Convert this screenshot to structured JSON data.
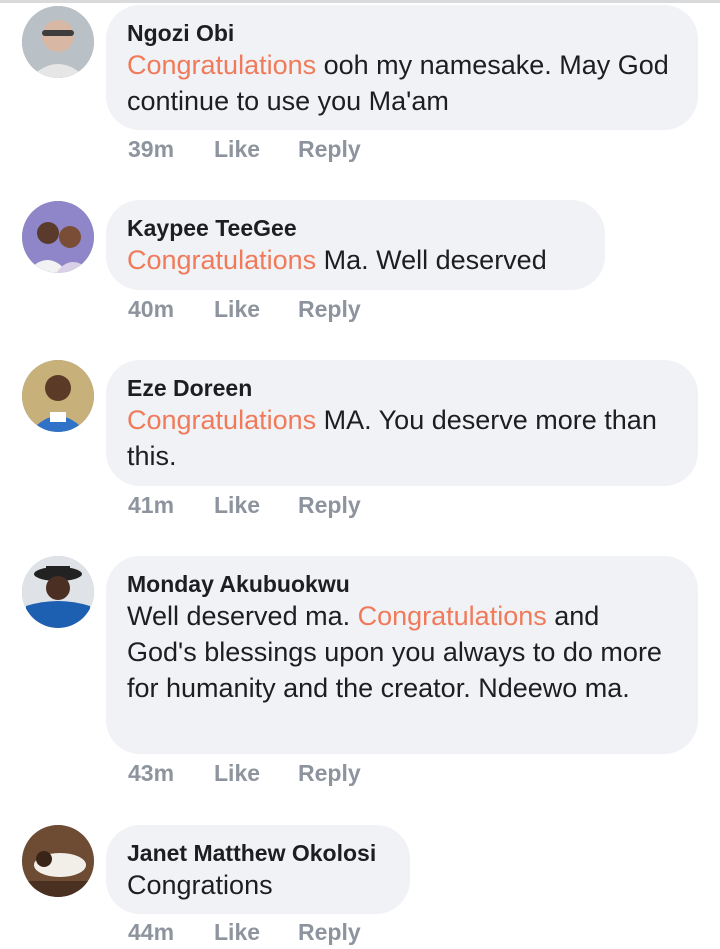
{
  "comments": [
    {
      "author": "Ngozi Obi",
      "before": "",
      "highlight": "Congratulations",
      "after": " ooh my namesake. May God continue to use you Ma'am",
      "time": "39m",
      "like": "Like",
      "reply": "Reply"
    },
    {
      "author": "Kaypee TeeGee",
      "before": "",
      "highlight": "Congratulations",
      "after": " Ma. Well deserved",
      "time": "40m",
      "like": "Like",
      "reply": "Reply"
    },
    {
      "author": "Eze Doreen",
      "before": "",
      "highlight": "Congratulations",
      "after": " MA. You deserve more than this.",
      "time": "41m",
      "like": "Like",
      "reply": "Reply"
    },
    {
      "author": "Monday Akubuokwu",
      "before": "Well deserved ma. ",
      "highlight": "Congratulations",
      "after": " and God's blessings upon you always to do more for humanity and the creator. Ndeewo ma.",
      "time": "43m",
      "like": "Like",
      "reply": "Reply"
    },
    {
      "author": "Janet Matthew Okolosi",
      "before": "Congrations",
      "highlight": "",
      "after": "",
      "time": "44m",
      "like": "Like",
      "reply": "Reply"
    }
  ],
  "colors": {
    "highlight": "#f07a5a",
    "bubble": "#f0f2f5",
    "meta": "#8d949e",
    "text": "#1c1e21"
  }
}
